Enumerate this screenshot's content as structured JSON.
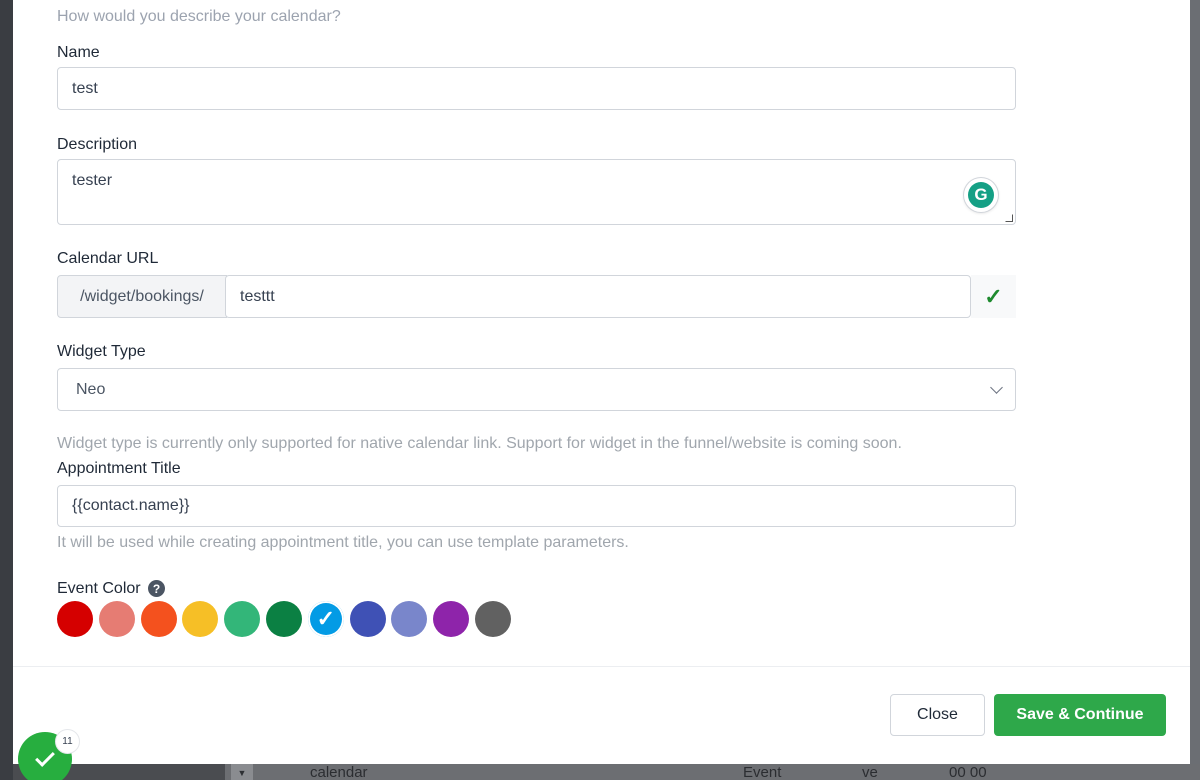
{
  "form": {
    "subtitle": "How would you describe your calendar?",
    "name": {
      "label": "Name",
      "value": "test"
    },
    "description": {
      "label": "Description",
      "value": "tester",
      "grammarly_letter": "G"
    },
    "calendar_url": {
      "label": "Calendar URL",
      "prefix": "/widget/bookings/",
      "value": "testtt",
      "status_glyph": "✓"
    },
    "widget_type": {
      "label": "Widget Type",
      "selected": "Neo",
      "hint": "Widget type is currently only supported for native calendar link. Support for widget in the funnel/website is coming soon."
    },
    "appointment_title": {
      "label": "Appointment Title",
      "value": "{{contact.name}}",
      "hint": "It will be used while creating appointment title, you can use template parameters."
    },
    "event_color": {
      "label": "Event Color",
      "help_glyph": "?",
      "selected_index": 6,
      "check_glyph": "✓",
      "colors": [
        "#d50000",
        "#e67c73",
        "#f4511e",
        "#f6bf26",
        "#33b679",
        "#0b8043",
        "#039be5",
        "#3f51b5",
        "#7986cb",
        "#8e24aa",
        "#616161"
      ]
    }
  },
  "footer": {
    "close_label": "Close",
    "save_label": "Save & Continue"
  },
  "notification": {
    "count": "11"
  },
  "background": {
    "row_text_1": "calendar",
    "row_text_2": "Event",
    "row_text_3": "ve",
    "row_text_4": "00 00"
  }
}
